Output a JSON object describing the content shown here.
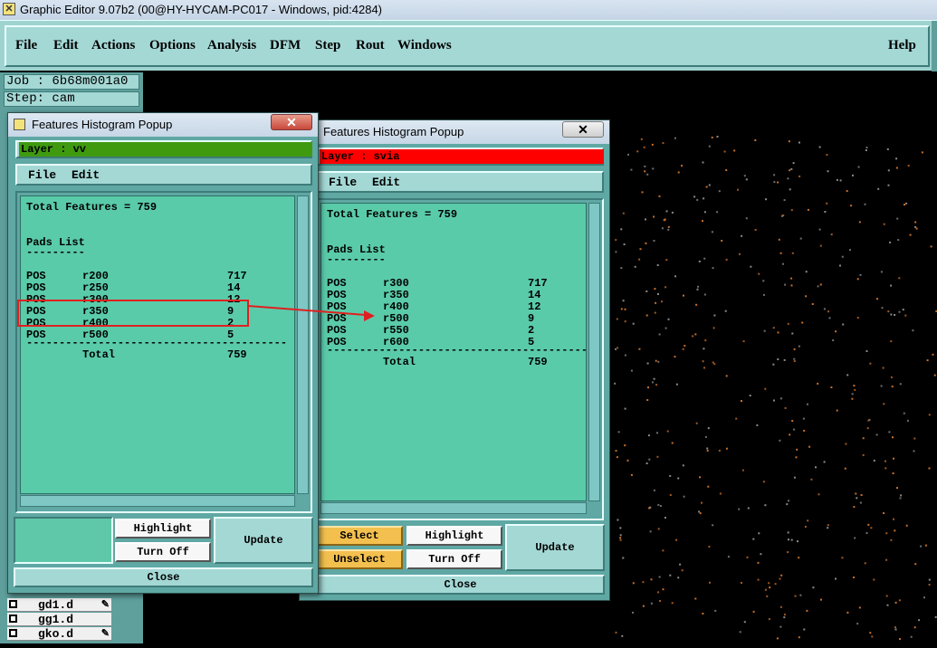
{
  "window": {
    "title": "Graphic Editor 9.07b2 (00@HY-HYCAM-PC017 - Windows, pid:4284)"
  },
  "menubar": {
    "items": [
      {
        "label": "File"
      },
      {
        "label": "Edit"
      },
      {
        "label": "Actions"
      },
      {
        "label": "Options"
      },
      {
        "label": "Analysis"
      },
      {
        "label": "DFM"
      },
      {
        "label": "Step"
      },
      {
        "label": "Rout"
      },
      {
        "label": "Windows"
      }
    ],
    "help": "Help"
  },
  "job": {
    "job_label": "Job : 6b68m001a0",
    "step_label": "Step: cam"
  },
  "files": [
    {
      "name": "gd1.d",
      "editable": true
    },
    {
      "name": "gg1.d",
      "editable": false
    },
    {
      "name": "gko.d",
      "editable": true
    }
  ],
  "popup_left": {
    "title": "Features Histogram Popup",
    "close_icon": "✕",
    "layer_label": "Layer :  vv",
    "layer_color": "#3f9a10",
    "menu": {
      "file": "File",
      "edit": "Edit"
    },
    "total_line": "Total Features = 759",
    "pads_heading": "Pads List",
    "pads_underline": "---------",
    "pads": [
      {
        "pol": "POS",
        "sym": "r200",
        "count": "717"
      },
      {
        "pol": "POS",
        "sym": "r250",
        "count": "14"
      },
      {
        "pol": "POS",
        "sym": "r300",
        "count": "12"
      },
      {
        "pol": "POS",
        "sym": "r350",
        "count": "9"
      },
      {
        "pol": "POS",
        "sym": "r400",
        "count": "2"
      },
      {
        "pol": "POS",
        "sym": "r500",
        "count": "5"
      }
    ],
    "separator": "----------------------------------------",
    "total_label": "Total",
    "total_value": "759",
    "buttons": {
      "highlight": "Highlight",
      "turn_off": "Turn Off",
      "update": "Update",
      "close": "Close"
    }
  },
  "popup_right": {
    "title": "Features Histogram Popup",
    "close_icon": "✕",
    "layer_label": "Layer :  svia",
    "layer_color": "#ff0000",
    "menu": {
      "file": "File",
      "edit": "Edit"
    },
    "total_line": "Total Features = 759",
    "pads_heading": "Pads List",
    "pads_underline": "---------",
    "pads": [
      {
        "pol": "POS",
        "sym": "r300",
        "count": "717"
      },
      {
        "pol": "POS",
        "sym": "r350",
        "count": "14"
      },
      {
        "pol": "POS",
        "sym": "r400",
        "count": "12"
      },
      {
        "pol": "POS",
        "sym": "r500",
        "count": "9"
      },
      {
        "pol": "POS",
        "sym": "r550",
        "count": "2"
      },
      {
        "pol": "POS",
        "sym": "r600",
        "count": "5"
      }
    ],
    "separator": "----------------------------------------",
    "total_label": "Total",
    "total_value": "759",
    "buttons": {
      "select": "Select",
      "unselect": "Unselect",
      "highlight": "Highlight",
      "turn_off": "Turn Off",
      "update": "Update",
      "close": "Close"
    }
  },
  "annotation": {
    "highlight_color": "#e02020"
  }
}
